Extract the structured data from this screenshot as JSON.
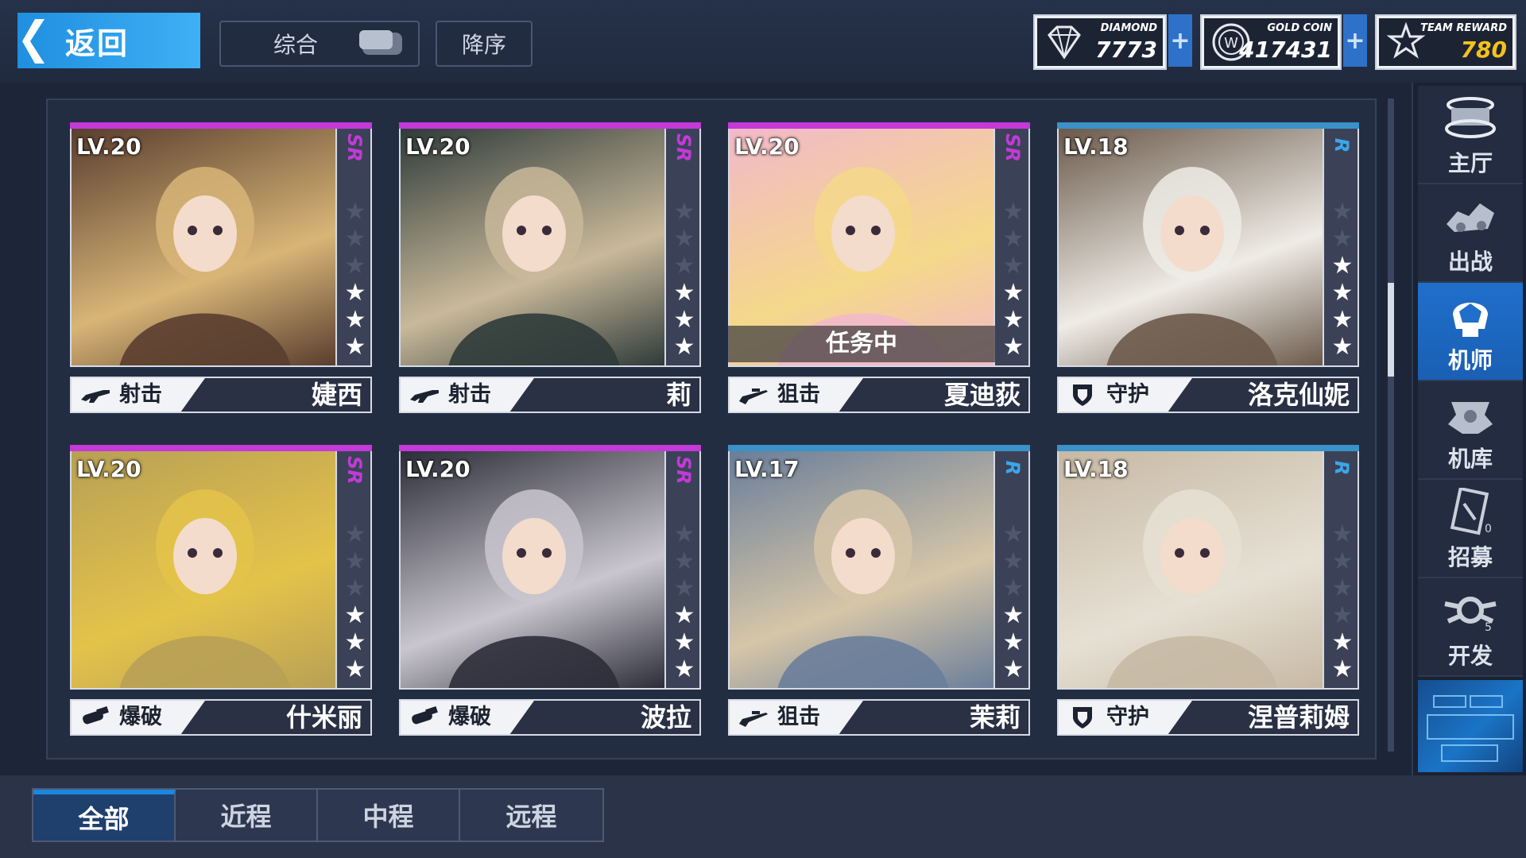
{
  "header": {
    "back_label": "返回",
    "sort_label": "综合",
    "order_label": "降序"
  },
  "currencies": {
    "diamond": {
      "caption": "DIAMOND",
      "value": "7773"
    },
    "gold": {
      "caption": "GOLD COIN",
      "value": "417431"
    },
    "team": {
      "caption": "TEAM REWARD",
      "value": "780"
    }
  },
  "cards": [
    {
      "level": "LV.20",
      "rarity": "SR",
      "stars": 3,
      "role": "射击",
      "name": "婕西",
      "status": ""
    },
    {
      "level": "LV.20",
      "rarity": "SR",
      "stars": 3,
      "role": "射击",
      "name": "莉",
      "status": ""
    },
    {
      "level": "LV.20",
      "rarity": "SR",
      "stars": 3,
      "role": "狙击",
      "name": "夏迪荻",
      "status": "任务中"
    },
    {
      "level": "LV.18",
      "rarity": "R",
      "stars": 4,
      "role": "守护",
      "name": "洛克仙妮",
      "status": ""
    },
    {
      "level": "LV.20",
      "rarity": "SR",
      "stars": 3,
      "role": "爆破",
      "name": "什米丽",
      "status": ""
    },
    {
      "level": "LV.20",
      "rarity": "SR",
      "stars": 3,
      "role": "爆破",
      "name": "波拉",
      "status": ""
    },
    {
      "level": "LV.17",
      "rarity": "R",
      "stars": 3,
      "role": "狙击",
      "name": "茉莉",
      "status": ""
    },
    {
      "level": "LV.18",
      "rarity": "R",
      "stars": 2,
      "role": "守护",
      "name": "涅普莉姆",
      "status": ""
    }
  ],
  "sidebar": {
    "items": [
      {
        "label": "主厅",
        "icon": "hall-icon"
      },
      {
        "label": "出战",
        "icon": "sortie-icon"
      },
      {
        "label": "机师",
        "icon": "pilot-icon"
      },
      {
        "label": "机库",
        "icon": "hangar-icon"
      },
      {
        "label": "招募",
        "icon": "recruit-icon",
        "badge": "0"
      },
      {
        "label": "开发",
        "icon": "develop-icon",
        "badge": "5"
      }
    ],
    "active": "机师"
  },
  "tabs": {
    "items": [
      "全部",
      "近程",
      "中程",
      "远程"
    ],
    "active": "全部"
  },
  "colors": {
    "accent": "#1f8fe0",
    "sr": "#c33ad8",
    "r": "#3aa7ea",
    "gold_value": "#f4c21c"
  }
}
